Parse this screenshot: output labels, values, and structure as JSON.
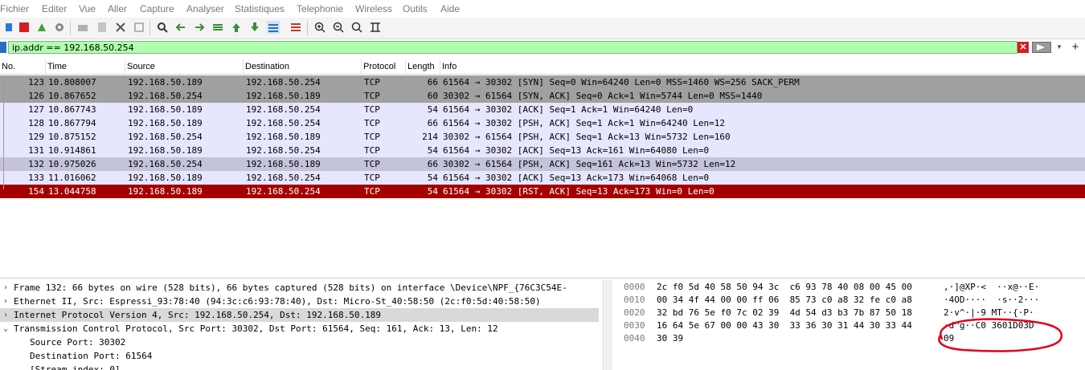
{
  "menu": [
    "Fichier",
    "Editer",
    "Vue",
    "Aller",
    "Capture",
    "Analyser",
    "Statistiques",
    "Telephonie",
    "Wireless",
    "Outils",
    "Aide"
  ],
  "filter": {
    "value": "ip.addr == 192.168.50.254"
  },
  "columns": [
    "No.",
    "Time",
    "Source",
    "Destination",
    "Protocol",
    "Length",
    "Info"
  ],
  "packets": [
    {
      "no": "123",
      "time": "10.808007",
      "src": "192.168.50.189",
      "dst": "192.168.50.254",
      "proto": "TCP",
      "len": "66",
      "info": "61564 → 30302 [SYN] Seq=0 Win=64240 Len=0 MSS=1460 WS=256 SACK_PERM",
      "bg": "#a0a0a0"
    },
    {
      "no": "126",
      "time": "10.867652",
      "src": "192.168.50.254",
      "dst": "192.168.50.189",
      "proto": "TCP",
      "len": "60",
      "info": "30302 → 61564 [SYN, ACK] Seq=0 Ack=1 Win=5744 Len=0 MSS=1440",
      "bg": "#a0a0a0"
    },
    {
      "no": "127",
      "time": "10.867743",
      "src": "192.168.50.189",
      "dst": "192.168.50.254",
      "proto": "TCP",
      "len": "54",
      "info": "61564 → 30302 [ACK] Seq=1 Ack=1 Win=64240 Len=0",
      "bg": "#e7e6ff"
    },
    {
      "no": "128",
      "time": "10.867794",
      "src": "192.168.50.189",
      "dst": "192.168.50.254",
      "proto": "TCP",
      "len": "66",
      "info": "61564 → 30302 [PSH, ACK] Seq=1 Ack=1 Win=64240 Len=12",
      "bg": "#e7e6ff"
    },
    {
      "no": "129",
      "time": "10.875152",
      "src": "192.168.50.254",
      "dst": "192.168.50.189",
      "proto": "TCP",
      "len": "214",
      "info": "30302 → 61564 [PSH, ACK] Seq=1 Ack=13 Win=5732 Len=160",
      "bg": "#e7e6ff"
    },
    {
      "no": "131",
      "time": "10.914861",
      "src": "192.168.50.189",
      "dst": "192.168.50.254",
      "proto": "TCP",
      "len": "54",
      "info": "61564 → 30302 [ACK] Seq=13 Ack=161 Win=64080 Len=0",
      "bg": "#e7e6ff"
    },
    {
      "no": "132",
      "time": "10.975026",
      "src": "192.168.50.254",
      "dst": "192.168.50.189",
      "proto": "TCP",
      "len": "66",
      "info": "30302 → 61564 [PSH, ACK] Seq=161 Ack=13 Win=5732 Len=12",
      "bg": "#c4c3da"
    },
    {
      "no": "133",
      "time": "11.016062",
      "src": "192.168.50.189",
      "dst": "192.168.50.254",
      "proto": "TCP",
      "len": "54",
      "info": "61564 → 30302 [ACK] Seq=13 Ack=173 Win=64068 Len=0",
      "bg": "#e7e6ff"
    },
    {
      "no": "154",
      "time": "13.044758",
      "src": "192.168.50.189",
      "dst": "192.168.50.254",
      "proto": "TCP",
      "len": "54",
      "info": "61564 → 30302 [RST, ACK] Seq=13 Ack=173 Win=0 Len=0",
      "bg": "#a40000",
      "selected": true
    }
  ],
  "details": [
    {
      "text": "Frame 132: 66 bytes on wire (528 bits), 66 bytes captured (528 bits) on interface \\Device\\NPF_{76C3C54E-",
      "expanded": false,
      "indent": 0
    },
    {
      "text": "Ethernet II, Src: Espressi_93:78:40 (94:3c:c6:93:78:40), Dst: Micro-St_40:58:50 (2c:f0:5d:40:58:50)",
      "expanded": false,
      "indent": 0
    },
    {
      "text": "Internet Protocol Version 4, Src: 192.168.50.254, Dst: 192.168.50.189",
      "expanded": false,
      "indent": 0,
      "highlight": true
    },
    {
      "text": "Transmission Control Protocol, Src Port: 30302, Dst Port: 61564, Seq: 161, Ack: 13, Len: 12",
      "expanded": true,
      "indent": 0
    },
    {
      "text": "Source Port: 30302",
      "indent": 1
    },
    {
      "text": "Destination Port: 61564",
      "indent": 1
    },
    {
      "text": "[Stream index: 0]",
      "indent": 1
    }
  ],
  "hex": [
    {
      "off": "0000",
      "bytes": "2c f0 5d 40 58 50 94 3c  c6 93 78 40 08 00 45 00",
      "ascii": ",·]@XP·<  ··x@··E·"
    },
    {
      "off": "0010",
      "bytes": "00 34 4f 44 00 00 ff 06  85 73 c0 a8 32 fe c0 a8",
      "ascii": "·4OD····  ·s··2···"
    },
    {
      "off": "0020",
      "bytes": "32 bd 76 5e f0 7c 02 39  4d 54 d3 b3 7b 87 50 18",
      "ascii": "2·v^·|·9 MT··{·P·"
    },
    {
      "off": "0030",
      "bytes": "16 64 5e 67 00 00 43 30  33 36 30 31 44 30 33 44",
      "ascii": "·d^g··C0 3601D03D"
    },
    {
      "off": "0040",
      "bytes": "30 39",
      "ascii": "09"
    }
  ],
  "colors": {
    "filter_bg": "#afffaf",
    "selected_row": "#a40000",
    "annotation": "#e0001b"
  }
}
